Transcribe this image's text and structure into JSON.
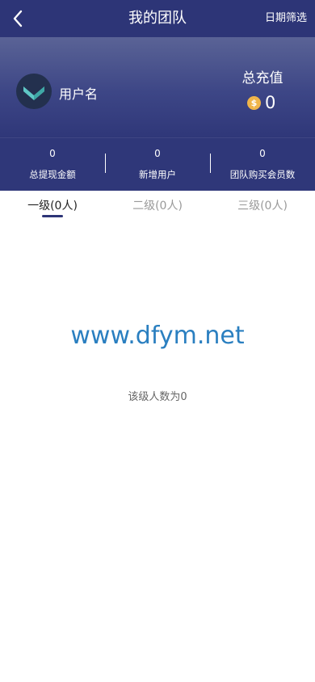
{
  "navbar": {
    "title": "我的团队",
    "filter_label": "日期筛选"
  },
  "profile": {
    "username": "用户名",
    "recharge_label": "总充值",
    "recharge_value": "0",
    "coin_symbol": "$"
  },
  "stats": [
    {
      "value": "0",
      "label": "总提现金额"
    },
    {
      "value": "0",
      "label": "新增用户"
    },
    {
      "value": "0",
      "label": "团队购买会员数"
    }
  ],
  "tabs": [
    {
      "label": "一级(0人)",
      "active": true
    },
    {
      "label": "二级(0人)",
      "active": false
    },
    {
      "label": "三级(0人)",
      "active": false
    }
  ],
  "watermark": "www.dfym.net",
  "empty_message": "该级人数为0",
  "colors": {
    "navbar": "#2d3577",
    "accent": "#2d3577",
    "coin": "#f0b54a",
    "avatar_check": "#5fc8c6",
    "watermark": "#2a7fc0"
  }
}
